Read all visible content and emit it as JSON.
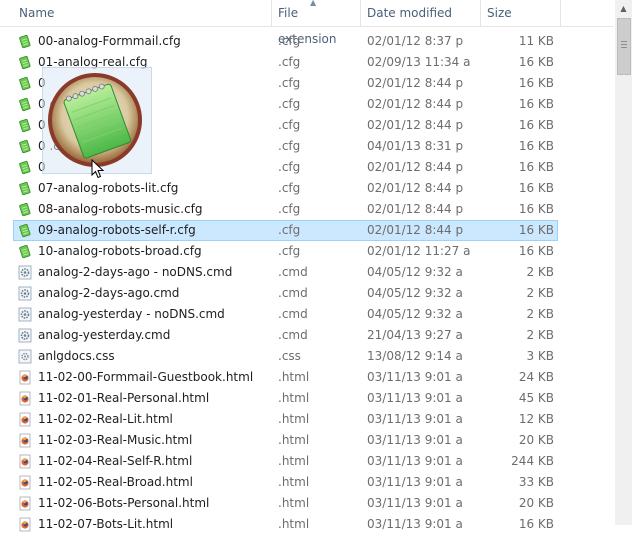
{
  "header": {
    "name": "Name",
    "file_extension": "File extension",
    "date_modified": "Date modified",
    "size": "Size"
  },
  "files": [
    {
      "name": "00-analog-Formmail.cfg",
      "ext": ".cfg",
      "date": "02/01/12 8:37 p",
      "size": "11 KB",
      "icon": "notepad-icon"
    },
    {
      "name": "01-analog-real.cfg",
      "ext": ".cfg",
      "date": "02/09/13 11:34 a",
      "size": "16 KB",
      "icon": "notepad-icon"
    },
    {
      "name": "0",
      "ext": ".cfg",
      "date": "02/01/12 8:44 p",
      "size": "16 KB",
      "icon": "notepad-icon"
    },
    {
      "name": "0                c.cfg",
      "ext": ".cfg",
      "date": "02/01/12 8:44 p",
      "size": "16 KB",
      "icon": "notepad-icon"
    },
    {
      "name": "0                .cfg",
      "ext": ".cfg",
      "date": "02/01/12 8:44 p",
      "size": "16 KB",
      "icon": "notepad-icon"
    },
    {
      "name": "0                 .cfg",
      "ext": ".cfg",
      "date": "04/01/13 8:31 p",
      "size": "16 KB",
      "icon": "notepad-icon"
    },
    {
      "name": "0",
      "ext": ".cfg",
      "date": "02/01/12 8:44 p",
      "size": "16 KB",
      "icon": "notepad-icon"
    },
    {
      "name": "07-analog-robots-lit.cfg",
      "ext": ".cfg",
      "date": "02/01/12 8:44 p",
      "size": "16 KB",
      "icon": "notepad-icon"
    },
    {
      "name": "08-analog-robots-music.cfg",
      "ext": ".cfg",
      "date": "02/01/12 8:44 p",
      "size": "16 KB",
      "icon": "notepad-icon"
    },
    {
      "name": "09-analog-robots-self-r.cfg",
      "ext": ".cfg",
      "date": "02/01/12 8:44 p",
      "size": "16 KB",
      "icon": "notepad-icon",
      "selected": true
    },
    {
      "name": "10-analog-robots-broad.cfg",
      "ext": ".cfg",
      "date": "02/01/12 11:27 a",
      "size": "16 KB",
      "icon": "notepad-icon"
    },
    {
      "name": "analog-2-days-ago - noDNS.cmd",
      "ext": ".cmd",
      "date": "04/05/12 9:32 a",
      "size": "2 KB",
      "icon": "cmd-gear-icon"
    },
    {
      "name": "analog-2-days-ago.cmd",
      "ext": ".cmd",
      "date": "04/05/12 9:32 a",
      "size": "2 KB",
      "icon": "cmd-gear-icon"
    },
    {
      "name": "analog-yesterday - noDNS.cmd",
      "ext": ".cmd",
      "date": "04/05/12 9:32 a",
      "size": "2 KB",
      "icon": "cmd-gear-icon"
    },
    {
      "name": "analog-yesterday.cmd",
      "ext": ".cmd",
      "date": "21/04/13 9:27 a",
      "size": "2 KB",
      "icon": "cmd-gear-icon"
    },
    {
      "name": "anlgdocs.css",
      "ext": ".css",
      "date": "13/08/12 9:14 a",
      "size": "3 KB",
      "icon": "css-file-icon"
    },
    {
      "name": "11-02-00-Formmail-Guestbook.html",
      "ext": ".html",
      "date": "03/11/13 9:01 a",
      "size": "24 KB",
      "icon": "firefox-html-icon"
    },
    {
      "name": "11-02-01-Real-Personal.html",
      "ext": ".html",
      "date": "03/11/13 9:01 a",
      "size": "45 KB",
      "icon": "firefox-html-icon"
    },
    {
      "name": "11-02-02-Real-Lit.html",
      "ext": ".html",
      "date": "03/11/13 9:01 a",
      "size": "12 KB",
      "icon": "firefox-html-icon"
    },
    {
      "name": "11-02-03-Real-Music.html",
      "ext": ".html",
      "date": "03/11/13 9:01 a",
      "size": "20 KB",
      "icon": "firefox-html-icon"
    },
    {
      "name": "11-02-04-Real-Self-R.html",
      "ext": ".html",
      "date": "03/11/13 9:01 a",
      "size": "244 KB",
      "icon": "firefox-html-icon"
    },
    {
      "name": "11-02-05-Real-Broad.html",
      "ext": ".html",
      "date": "03/11/13 9:01 a",
      "size": "33 KB",
      "icon": "firefox-html-icon"
    },
    {
      "name": "11-02-06-Bots-Personal.html",
      "ext": ".html",
      "date": "03/11/13 9:01 a",
      "size": "20 KB",
      "icon": "firefox-html-icon"
    },
    {
      "name": "11-02-07-Bots-Lit.html",
      "ext": ".html",
      "date": "03/11/13 9:01 a",
      "size": "16 KB",
      "icon": "firefox-html-icon"
    }
  ],
  "drag_preview": {
    "icon": "notepad-large-icon"
  },
  "colors": {
    "selection_bg": "#cce8ff",
    "selection_border": "#99d1ff",
    "header_text": "#4c607a"
  }
}
